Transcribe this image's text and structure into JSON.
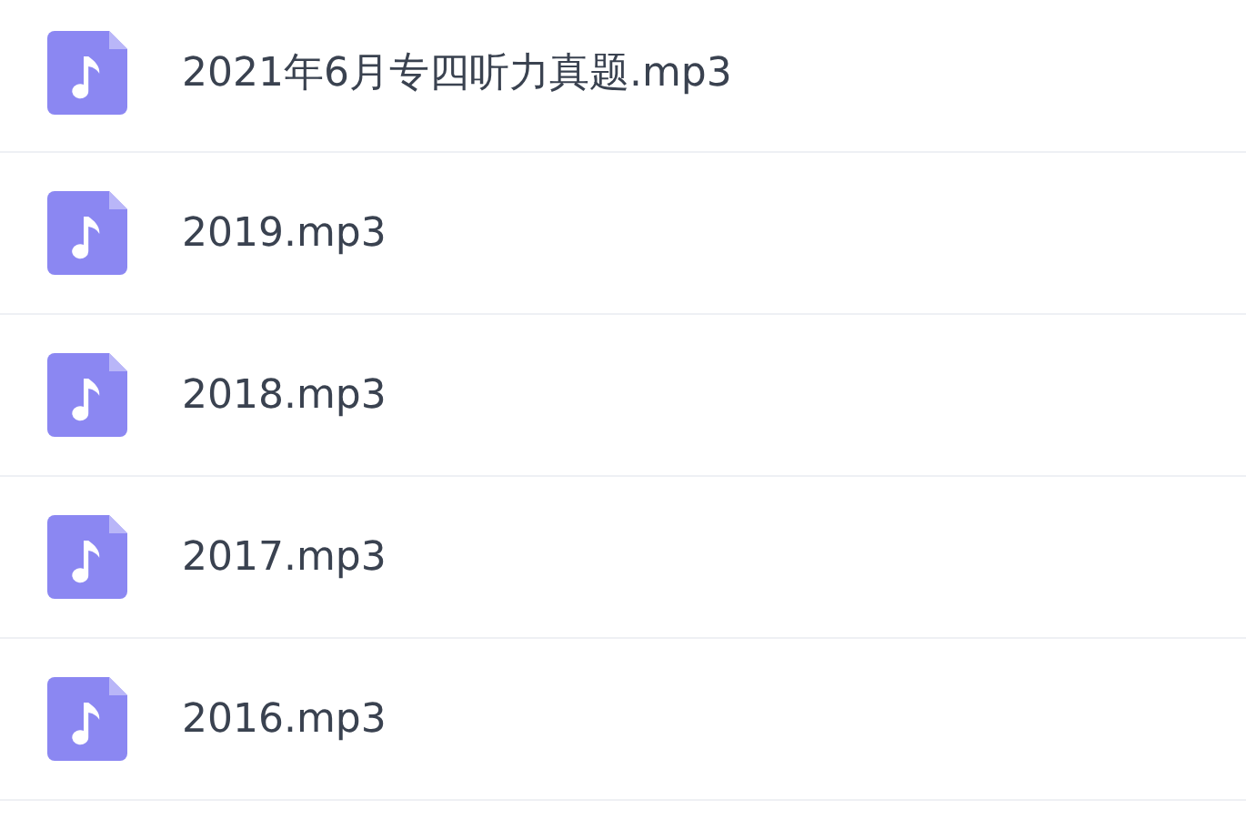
{
  "files": [
    {
      "name": "2021年6月专四听力真题.mp3"
    },
    {
      "name": "2019.mp3"
    },
    {
      "name": "2018.mp3"
    },
    {
      "name": "2017.mp3"
    },
    {
      "name": "2016.mp3"
    }
  ]
}
